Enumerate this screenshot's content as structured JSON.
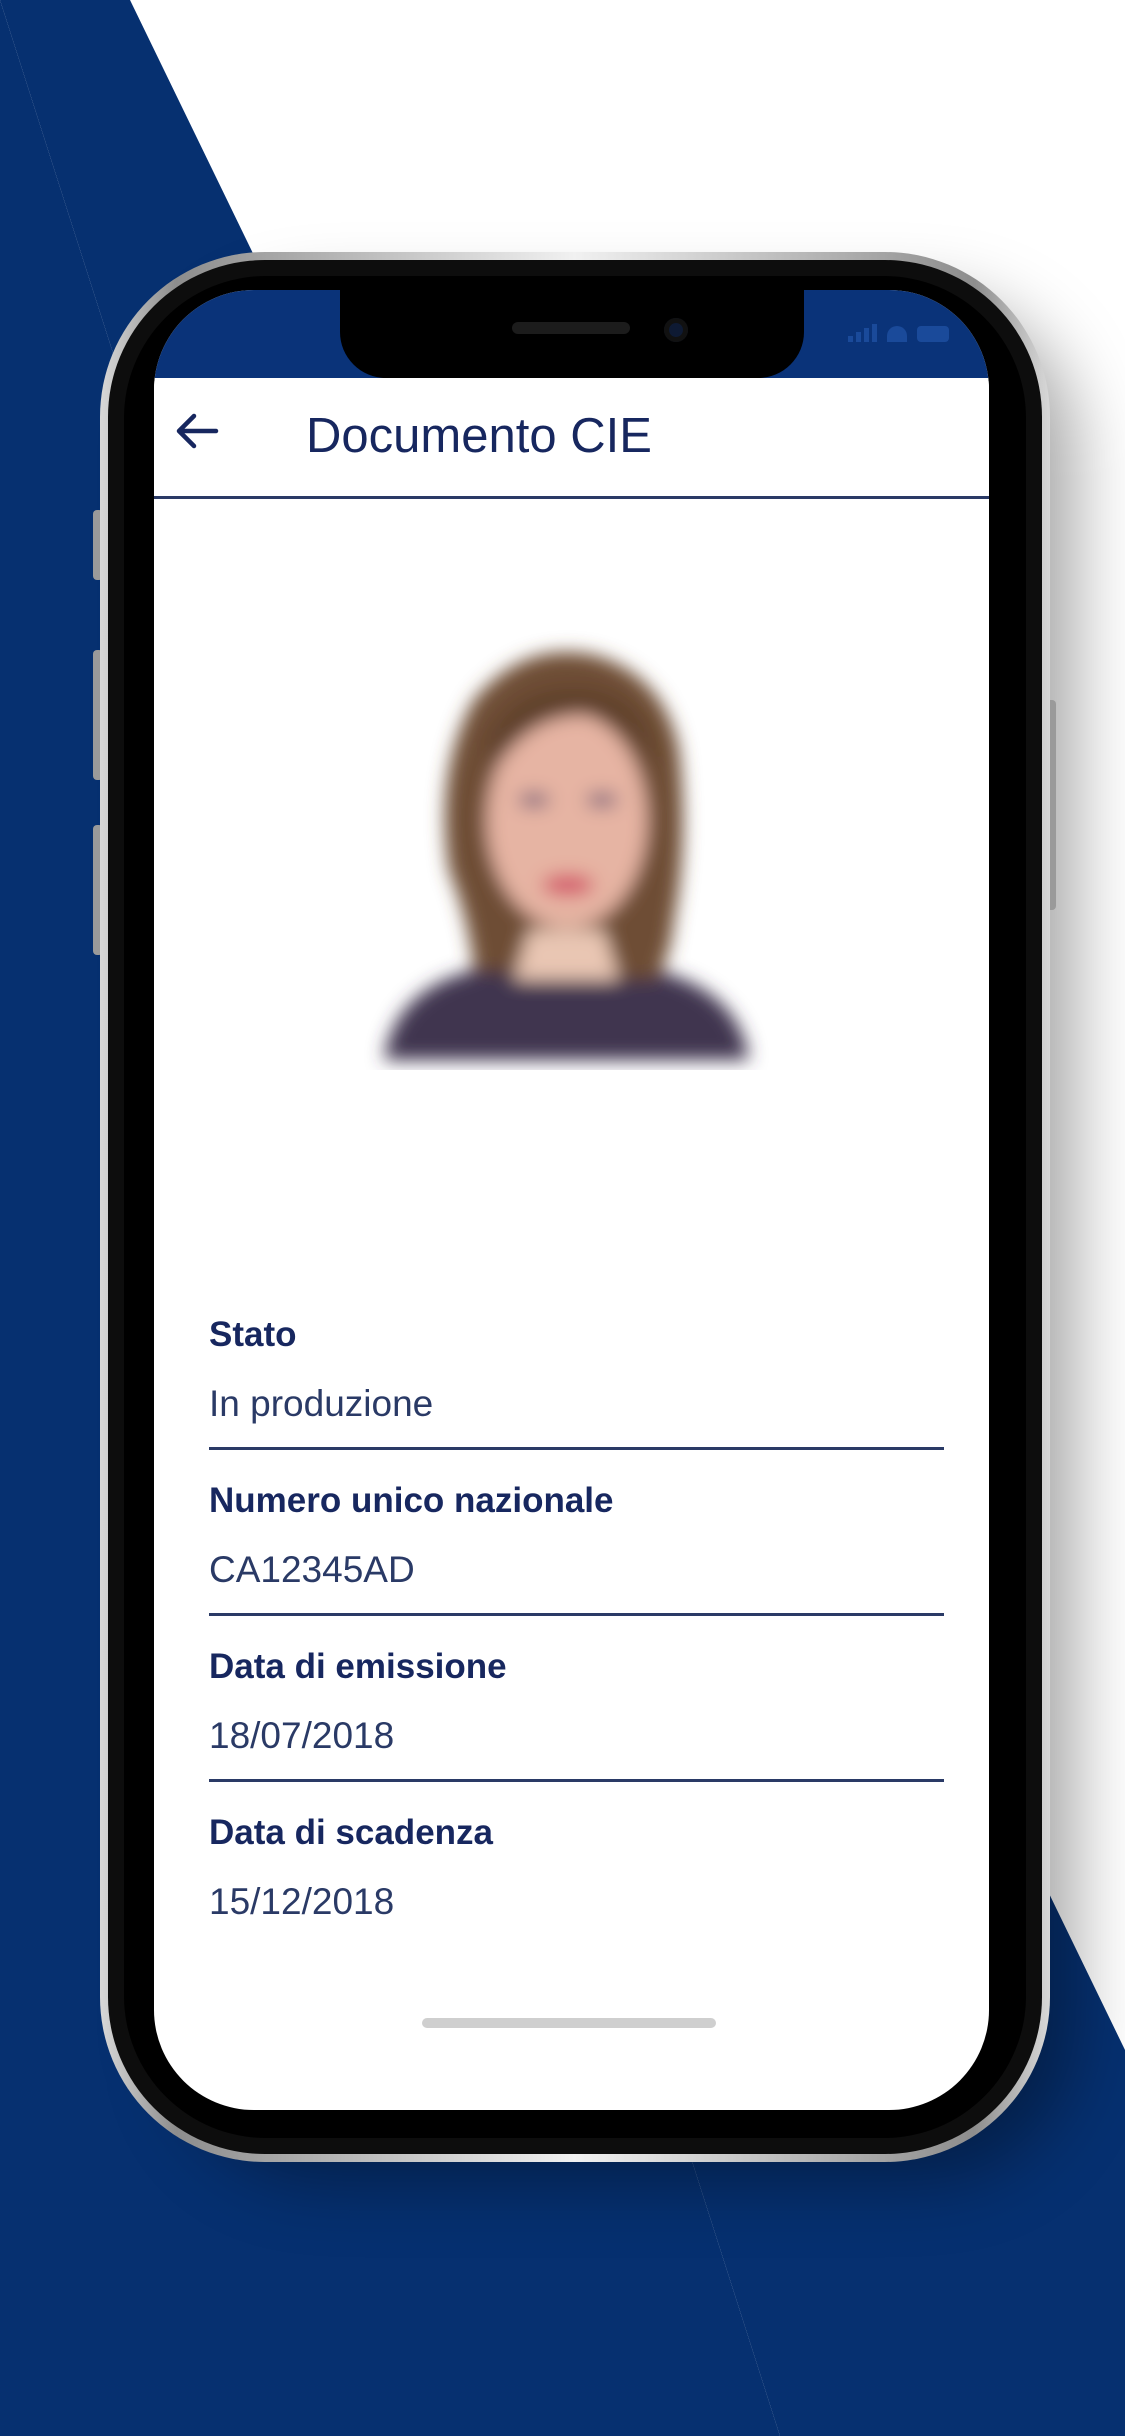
{
  "colors": {
    "brand_blue": "#0a3379",
    "text_dark": "#17275f",
    "divider": "#2a3a66",
    "background": "#ffffff"
  },
  "header": {
    "back_icon": "arrow-left-icon",
    "title": "Documento CIE"
  },
  "fields": [
    {
      "label": "Stato",
      "value": "In produzione"
    },
    {
      "label": "Numero unico nazionale",
      "value": "CA12345AD"
    },
    {
      "label": "Data di emissione",
      "value": "18/07/2018"
    },
    {
      "label": "Data di scadenza",
      "value": "15/12/2018"
    }
  ]
}
